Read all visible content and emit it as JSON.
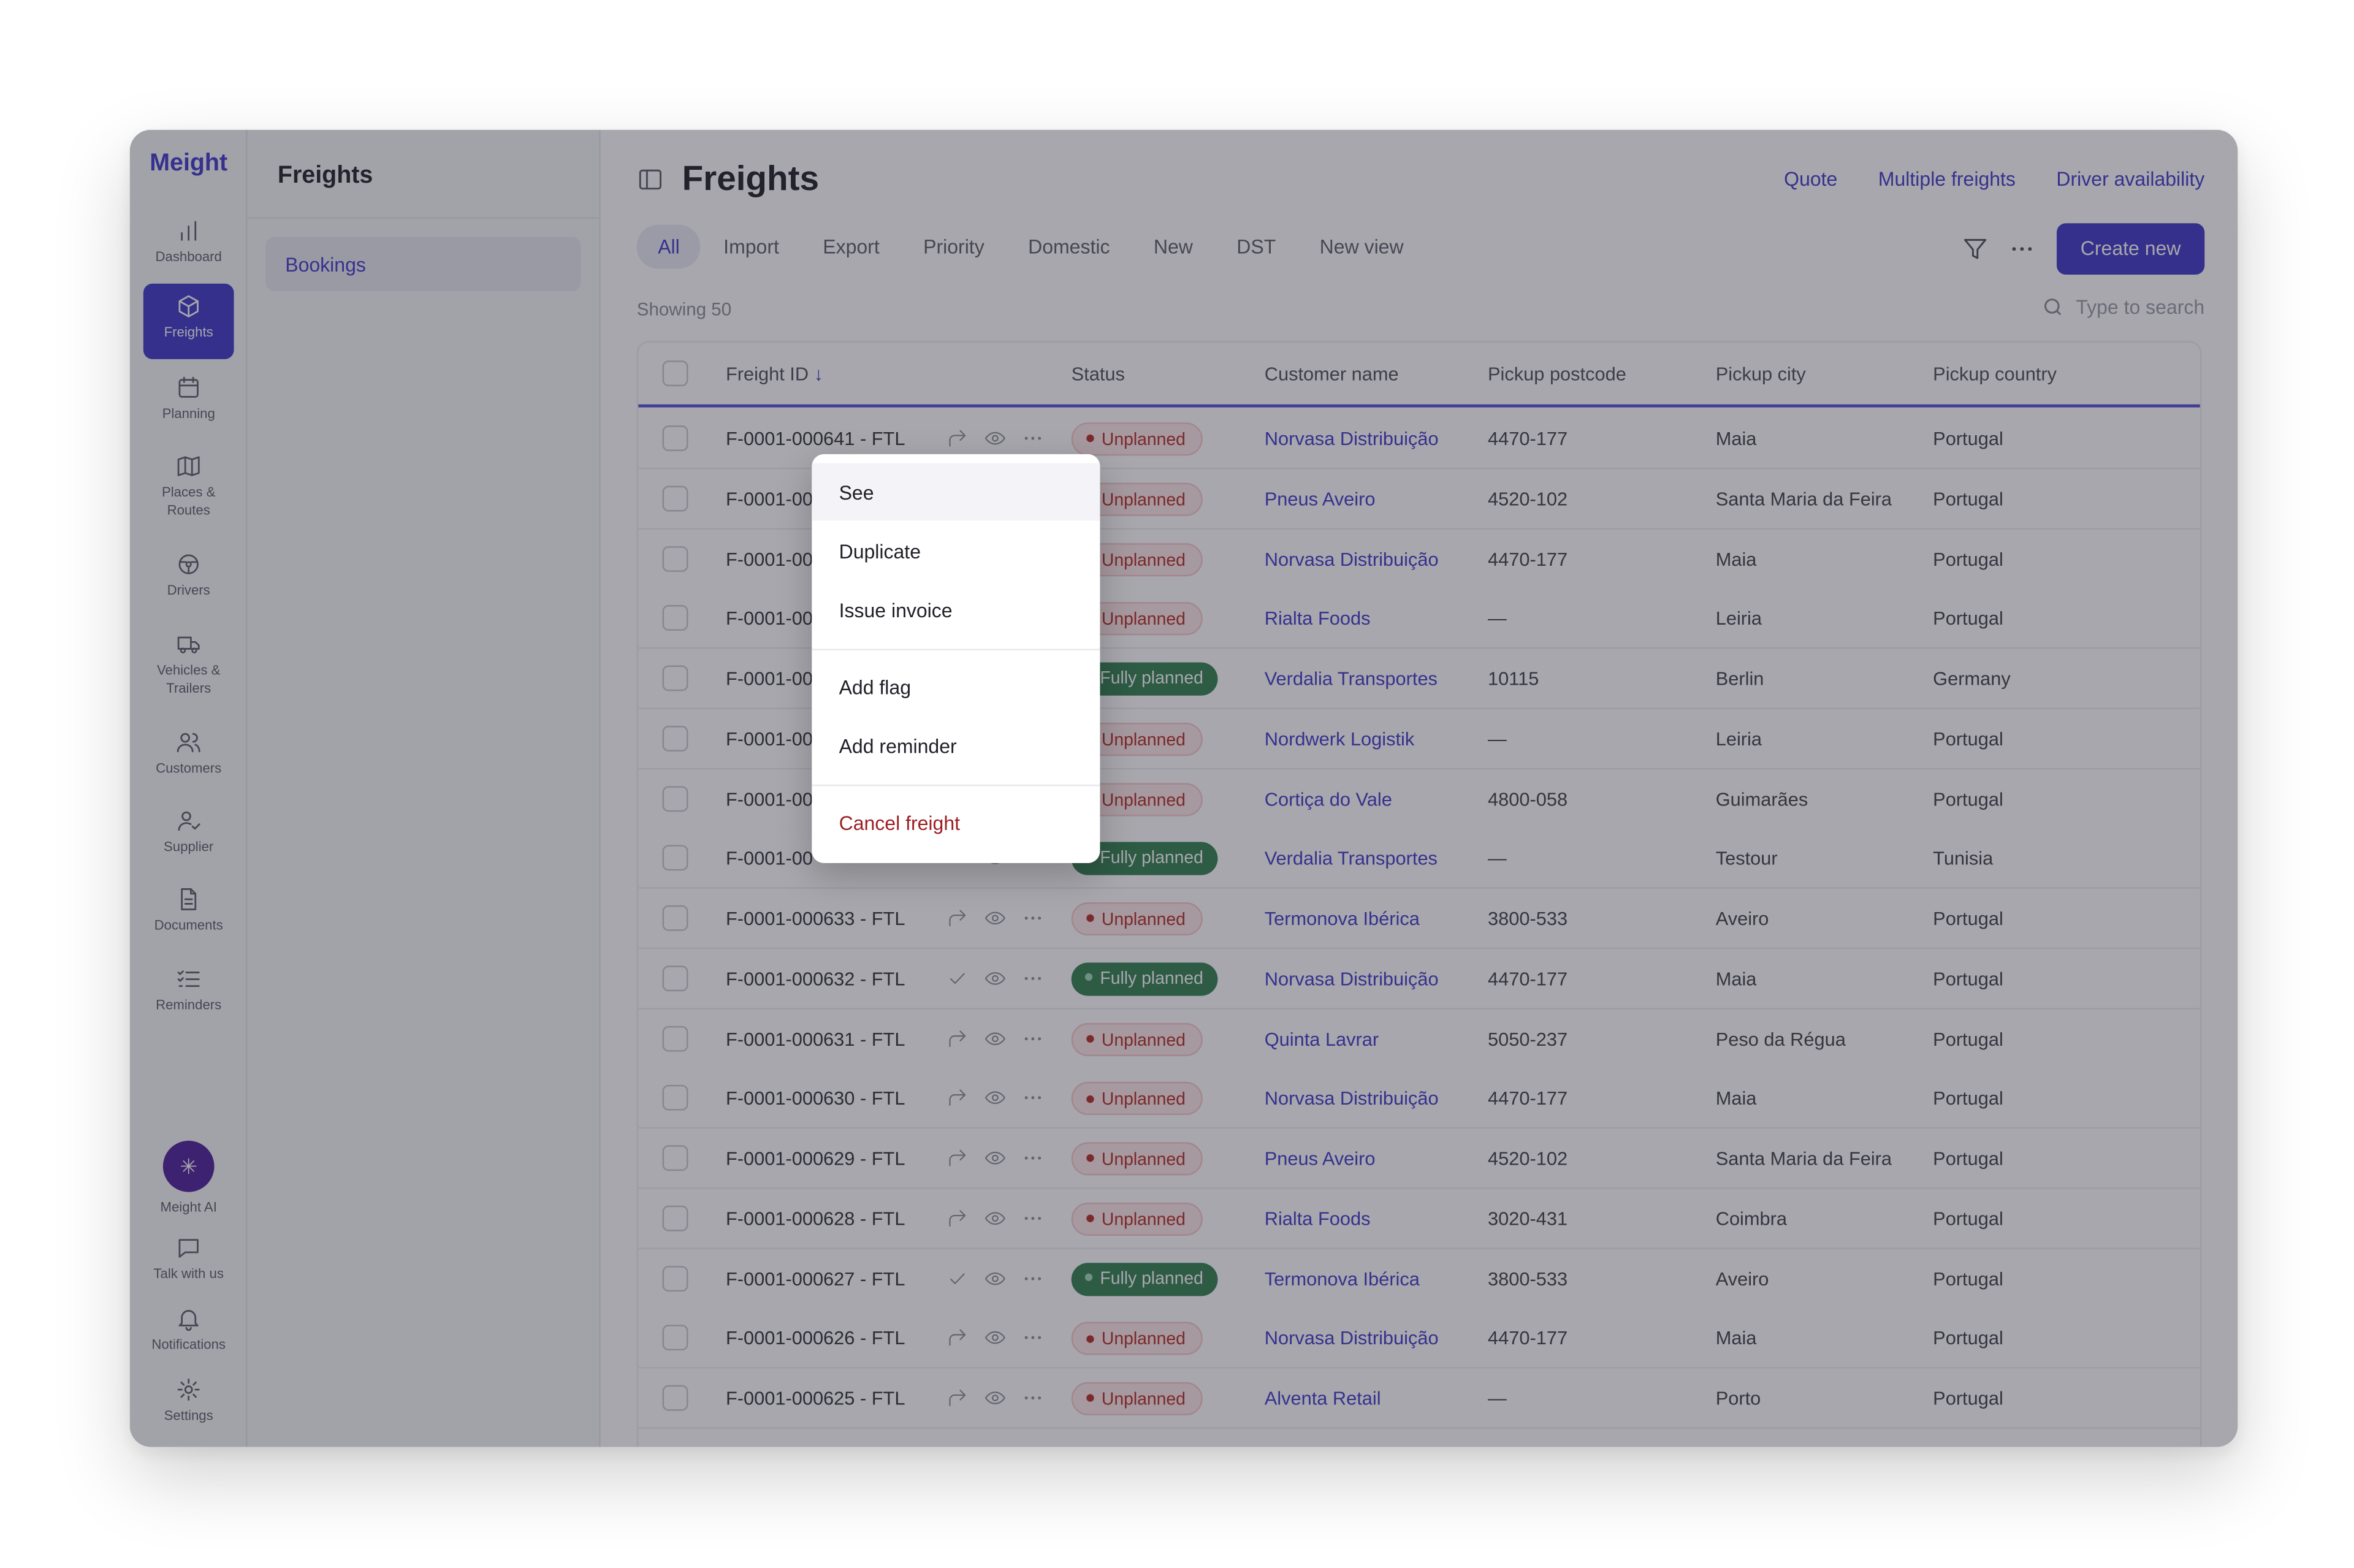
{
  "app": {
    "brand": "Meight"
  },
  "rail": {
    "items": [
      {
        "label": "Dashboard",
        "icon": "bar-chart-icon"
      },
      {
        "label": "Freights",
        "icon": "box-icon",
        "active": true
      },
      {
        "label": "Planning",
        "icon": "calendar-icon"
      },
      {
        "label": "Places & Routes",
        "icon": "map-icon"
      },
      {
        "label": "Drivers",
        "icon": "steering-wheel-icon"
      },
      {
        "label": "Vehicles & Trailers",
        "icon": "truck-icon"
      },
      {
        "label": "Customers",
        "icon": "users-icon"
      },
      {
        "label": "Supplier",
        "icon": "user-check-icon"
      },
      {
        "label": "Documents",
        "icon": "document-icon"
      },
      {
        "label": "Reminders",
        "icon": "checklist-icon"
      }
    ],
    "bottom": [
      {
        "label": "Meight AI",
        "icon": "sparkle-icon"
      },
      {
        "label": "Talk with us",
        "icon": "chat-icon"
      },
      {
        "label": "Notifications",
        "icon": "bell-icon"
      },
      {
        "label": "Settings",
        "icon": "gear-icon"
      }
    ]
  },
  "subnav": {
    "title": "Freights",
    "items": [
      "Bookings"
    ]
  },
  "header": {
    "title": "Freights",
    "links": [
      "Quote",
      "Multiple freights",
      "Driver availability"
    ]
  },
  "views": [
    "All",
    "Import",
    "Export",
    "Priority",
    "Domestic",
    "New",
    "DST",
    "New view"
  ],
  "actions": {
    "create": "Create new"
  },
  "list": {
    "showing": "Showing 50",
    "search_placeholder": "Type to search"
  },
  "table": {
    "columns": [
      "Freight ID",
      "Status",
      "Customer name",
      "Pickup postcode",
      "Pickup city",
      "Pickup country"
    ],
    "sort_column": "Freight ID",
    "sort_direction": "descending",
    "rows": [
      {
        "id": "F-0001-000641 - FTL",
        "status": "Unplanned",
        "customer": "Norvasa Distribuição",
        "postcode": "4470-177",
        "city": "Maia",
        "country": "Portugal"
      },
      {
        "id": "F-0001-00",
        "status": "Unplanned",
        "customer": "Pneus Aveiro",
        "postcode": "4520-102",
        "city": "Santa Maria da Feira",
        "country": "Portugal"
      },
      {
        "id": "F-0001-00",
        "status": "Unplanned",
        "customer": "Norvasa Distribuição",
        "postcode": "4470-177",
        "city": "Maia",
        "country": "Portugal"
      },
      {
        "id": "F-0001-00",
        "status": "Unplanned",
        "customer": "Rialta Foods",
        "postcode": "—",
        "city": "Leiria",
        "country": "Portugal"
      },
      {
        "id": "F-0001-00",
        "status": "Fully planned",
        "customer": "Verdalia Transportes",
        "postcode": "10115",
        "city": "Berlin",
        "country": "Germany"
      },
      {
        "id": "F-0001-00",
        "status": "Unplanned",
        "customer": "Nordwerk Logistik",
        "postcode": "—",
        "city": "Leiria",
        "country": "Portugal"
      },
      {
        "id": "F-0001-00",
        "status": "Unplanned",
        "customer": "Cortiça do Vale",
        "postcode": "4800-058",
        "city": "Guimarães",
        "country": "Portugal"
      },
      {
        "id": "F-0001-00",
        "status": "Fully planned",
        "customer": "Verdalia Transportes",
        "postcode": "—",
        "city": "Testour",
        "country": "Tunisia"
      },
      {
        "id": "F-0001-000633 - FTL",
        "status": "Unplanned",
        "customer": "Termonova Ibérica",
        "postcode": "3800-533",
        "city": "Aveiro",
        "country": "Portugal"
      },
      {
        "id": "F-0001-000632 - FTL",
        "status": "Fully planned",
        "customer": "Norvasa Distribuição",
        "postcode": "4470-177",
        "city": "Maia",
        "country": "Portugal"
      },
      {
        "id": "F-0001-000631 - FTL",
        "status": "Unplanned",
        "customer": "Quinta Lavrar",
        "postcode": "5050-237",
        "city": "Peso da Régua",
        "country": "Portugal"
      },
      {
        "id": "F-0001-000630 - FTL",
        "status": "Unplanned",
        "customer": "Norvasa Distribuição",
        "postcode": "4470-177",
        "city": "Maia",
        "country": "Portugal"
      },
      {
        "id": "F-0001-000629 - FTL",
        "status": "Unplanned",
        "customer": "Pneus Aveiro",
        "postcode": "4520-102",
        "city": "Santa Maria da Feira",
        "country": "Portugal"
      },
      {
        "id": "F-0001-000628 - FTL",
        "status": "Unplanned",
        "customer": "Rialta Foods",
        "postcode": "3020-431",
        "city": "Coimbra",
        "country": "Portugal"
      },
      {
        "id": "F-0001-000627 - FTL",
        "status": "Fully planned",
        "customer": "Termonova Ibérica",
        "postcode": "3800-533",
        "city": "Aveiro",
        "country": "Portugal"
      },
      {
        "id": "F-0001-000626 - FTL",
        "status": "Unplanned",
        "customer": "Norvasa Distribuição",
        "postcode": "4470-177",
        "city": "Maia",
        "country": "Portugal"
      },
      {
        "id": "F-0001-000625 - FTL",
        "status": "Unplanned",
        "customer": "Alventa Retail",
        "postcode": "—",
        "city": "Porto",
        "country": "Portugal"
      }
    ]
  },
  "context_menu": {
    "groups": [
      [
        "See",
        "Duplicate",
        "Issue invoice"
      ],
      [
        "Add flag",
        "Add reminder"
      ],
      [
        "Cancel freight"
      ]
    ]
  },
  "colors": {
    "accent": "#3a33c7",
    "unplanned": "#b3261e",
    "planned": "#2e7d4b",
    "danger": "#9c1f24"
  }
}
